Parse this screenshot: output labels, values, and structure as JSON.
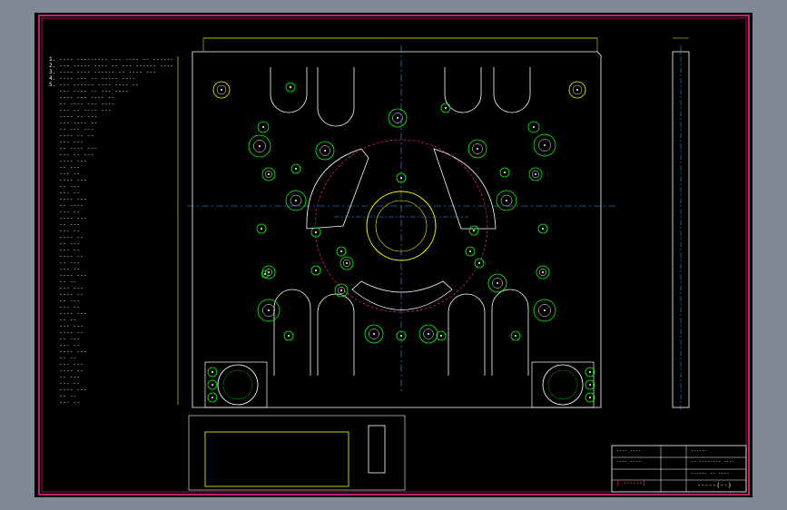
{
  "drawing": {
    "colors": {
      "paper": "#000000",
      "background": "#7f8996",
      "border": "#ff2a8a",
      "outline": "#ffff00",
      "centerline": "#3aa0ff",
      "holes": "#00ff00",
      "frame": "#ffffff"
    },
    "notes_lines": [
      "1. ---- --------- --- ---- -- ------",
      "2. --- ----- ---- -- --- ------ ----",
      "3. ---- ---- ------ -- ---- ---",
      "4. ---- --- -- ----- ----",
      "5. --- ------ ---- ---- --",
      "   --- ---- -- --- ----",
      "   ---- --- ---- --",
      "   -- ---- --- ----",
      "   --- -- ---- ---",
      "   ---- -- ---",
      "   --- ---- --",
      "   -- --- ---",
      "   ---- -- --",
      "   --- ---",
      "   -- ---- ---",
      "   --- -- ---",
      "   ---- ---",
      "   -- ---",
      "   --- --",
      "   ---- ---",
      "   -- ---",
      "   --- --",
      "   ---- ---",
      "   -- ----",
      "   --- --",
      "   ---- ---",
      "   -- ---",
      "   --- --",
      "   ---- --",
      "   -- ---",
      "   --- --",
      "   ---- --",
      "   -- ---",
      "   --- --",
      "   ---- ---",
      "   -- --",
      "   --- ---",
      "   ---- --",
      "   -- ---",
      "   --- --",
      "   ---- ---",
      "   -- --",
      "   --- ---",
      "   ---- --",
      "   -- ---",
      "   --- --",
      "   ---- ---",
      "   -- --",
      "   --- ---",
      "   ---- --",
      "   -- ---",
      "   --- --",
      "   ---- ---",
      "   -- --",
      "   --- --"
    ],
    "title_block": {
      "line1": "---- ----",
      "line2": "------",
      "line3": "-- -------- ----",
      "line4": "---- ----",
      "line5": "------ -- ----",
      "logo": "| ------|",
      "number": "-----(--)"
    }
  }
}
